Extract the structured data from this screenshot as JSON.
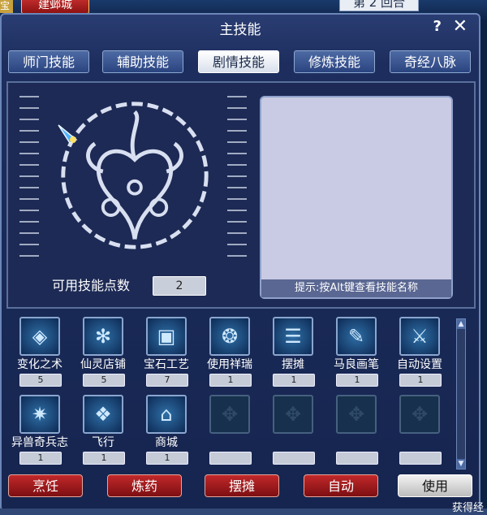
{
  "game_bar": {
    "city": "建邺城",
    "round_text": "第 2 回合",
    "edge_text": "宝",
    "corner_text": "获得经"
  },
  "window": {
    "title": "主技能",
    "help": "?",
    "close": "✕"
  },
  "tabs": [
    "师门技能",
    "辅助技能",
    "剧情技能",
    "修炼技能",
    "奇经八脉"
  ],
  "active_tab": "剧情技能",
  "skill_points": {
    "label": "可用技能点数",
    "value": "2"
  },
  "hint": "提示:按Alt键查看技能名称",
  "skills": [
    {
      "name": "变化之术",
      "count": "5",
      "icon": "mirror-icon"
    },
    {
      "name": "仙灵店铺",
      "count": "5",
      "icon": "shop-icon"
    },
    {
      "name": "宝石工艺",
      "count": "7",
      "icon": "gem-icon"
    },
    {
      "name": "使用祥瑞",
      "count": "1",
      "icon": "beast-icon"
    },
    {
      "name": "摆摊",
      "count": "1",
      "icon": "stall-icon"
    },
    {
      "name": "马良画笔",
      "count": "1",
      "icon": "brush-icon"
    },
    {
      "name": "自动设置",
      "count": "1",
      "icon": "swords-icon"
    },
    {
      "name": "异兽奇兵志",
      "count": "1",
      "icon": "weapon-icon"
    },
    {
      "name": "飞行",
      "count": "1",
      "icon": "wings-icon"
    },
    {
      "name": "商城",
      "count": "1",
      "icon": "store-icon"
    },
    {
      "name": "",
      "count": "",
      "icon": "empty-slot-icon"
    },
    {
      "name": "",
      "count": "",
      "icon": "empty-slot-icon"
    },
    {
      "name": "",
      "count": "",
      "icon": "empty-slot-icon"
    },
    {
      "name": "",
      "count": "",
      "icon": "empty-slot-icon"
    }
  ],
  "actions": {
    "cook": "烹饪",
    "alchemy": "炼药",
    "stall": "摆摊",
    "auto": "自动",
    "use": "使用"
  }
}
